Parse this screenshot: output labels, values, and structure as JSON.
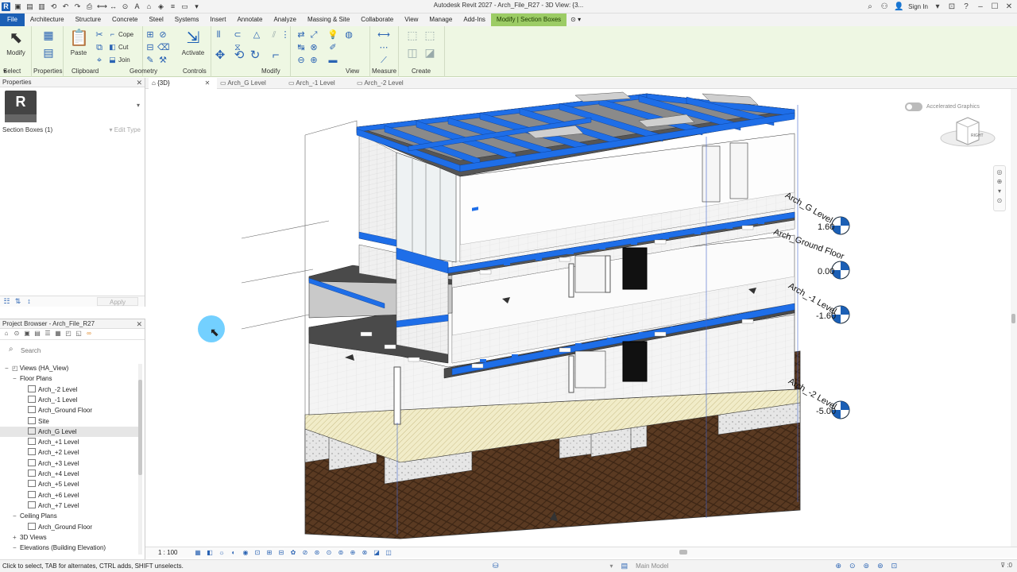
{
  "titlebar": {
    "title": "Autodesk Revit 2027 - Arch_File_R27 - 3D View: {3...",
    "sign_in": "Sign In"
  },
  "ribbon_tabs": [
    "File",
    "Architecture",
    "Structure",
    "Concrete",
    "Steel",
    "Systems",
    "Insert",
    "Annotate",
    "Analyze",
    "Massing & Site",
    "Collaborate",
    "View",
    "Manage",
    "Add-Ins",
    "Modify | Section Boxes"
  ],
  "ribbon": {
    "modify": "Modify",
    "paste": "Paste",
    "cope": "Cope",
    "cut": "Cut",
    "join": "Join",
    "activate": "Activate",
    "panels": {
      "select": "Select",
      "properties": "Properties",
      "clipboard": "Clipboard",
      "geometry": "Geometry",
      "controls": "Controls",
      "modify": "Modify",
      "view": "View",
      "measure": "Measure",
      "create": "Create"
    }
  },
  "properties": {
    "title": "Properties",
    "type_letter": "R",
    "filter": "Section Boxes (1)",
    "edit_type": "Edit Type",
    "apply": "Apply"
  },
  "browser": {
    "title": "Project Browser - Arch_File_R27",
    "search_placeholder": "Search",
    "tree": [
      {
        "label": "Views (HA_View)",
        "level": 0,
        "toggle": "−"
      },
      {
        "label": "Floor Plans",
        "level": 1,
        "toggle": "−"
      },
      {
        "label": "Arch_-2 Level",
        "level": 2
      },
      {
        "label": "Arch_-1 Level",
        "level": 2
      },
      {
        "label": "Arch_Ground Floor",
        "level": 2
      },
      {
        "label": "Site",
        "level": 2
      },
      {
        "label": "Arch_G Level",
        "level": 2,
        "selected": true
      },
      {
        "label": "Arch_+1 Level",
        "level": 2
      },
      {
        "label": "Arch_+2 Level",
        "level": 2
      },
      {
        "label": "Arch_+3 Level",
        "level": 2
      },
      {
        "label": "Arch_+4 Level",
        "level": 2
      },
      {
        "label": "Arch_+5 Level",
        "level": 2
      },
      {
        "label": "Arch_+6 Level",
        "level": 2
      },
      {
        "label": "Arch_+7 Level",
        "level": 2
      },
      {
        "label": "Ceiling Plans",
        "level": 1,
        "toggle": "−"
      },
      {
        "label": "Arch_Ground Floor",
        "level": 2
      },
      {
        "label": "3D Views",
        "level": 1,
        "toggle": "+"
      },
      {
        "label": "Elevations (Building Elevation)",
        "level": 1,
        "toggle": "−"
      }
    ]
  },
  "view_tabs": [
    "{3D}",
    "Arch_G Level",
    "Arch_-1 Level",
    "Arch_-2 Level"
  ],
  "canvas": {
    "accelerated": "Accelerated Graphics",
    "viewcube_label": "RIGHT",
    "levels": [
      {
        "name": "Arch_G Level",
        "value": "1.60"
      },
      {
        "name": "Arch_Ground Floor",
        "value": "0.00"
      },
      {
        "name": "Arch_-1 Level",
        "value": "-1.60"
      },
      {
        "name": "Arch_-2 Level",
        "value": "-5.00"
      }
    ]
  },
  "viewbar": {
    "scale": "1 : 100"
  },
  "status": {
    "hint": "Click to select, TAB for alternates, CTRL adds, SHIFT unselects.",
    "model": "Main Model",
    "filter_count": ":0"
  },
  "colors": {
    "brand": "#1b5fb5",
    "context_tab": "#9ccc65",
    "ribbon_bg": "#eef7e3",
    "beam_blue": "#1e6ee8"
  }
}
